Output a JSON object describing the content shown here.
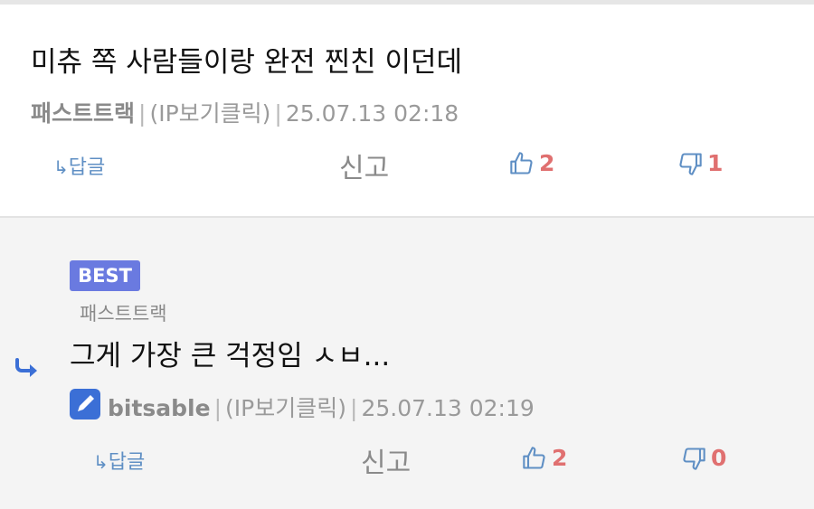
{
  "comment1": {
    "text": "미츄 쪽 사람들이랑 완전 찐친 이던데",
    "author": "패스트트랙",
    "ip_label": "(IP보기클릭)",
    "timestamp": "25.07.13 02:18",
    "separator": "|",
    "actions": {
      "reply_arrow": "↳",
      "reply_label": "답글",
      "report_label": "신고",
      "likes": "2",
      "dislikes": "1"
    }
  },
  "comment2": {
    "badge": "BEST",
    "parent_author": "패스트트랙",
    "text": "그게 가장 큰 걱정임 ㅅㅂ...",
    "author": "bitsable",
    "ip_label": "(IP보기클릭)",
    "timestamp": "25.07.13 02:19",
    "separator": "|",
    "actions": {
      "reply_arrow": "↳",
      "reply_label": "답글",
      "report_label": "신고",
      "likes": "2",
      "dislikes": "0"
    }
  },
  "colors": {
    "link_blue": "#5f8fc4",
    "vote_red": "#e07070",
    "badge_purple": "#6a7ae0",
    "author_icon_blue": "#3b6fd6",
    "reply_area_bg": "#f4f4f4"
  },
  "icons": {
    "like": "thumbs-up-icon",
    "dislike": "thumbs-down-icon",
    "reply_indicator": "reply-arrow-icon",
    "author_badge": "pencil-icon"
  }
}
